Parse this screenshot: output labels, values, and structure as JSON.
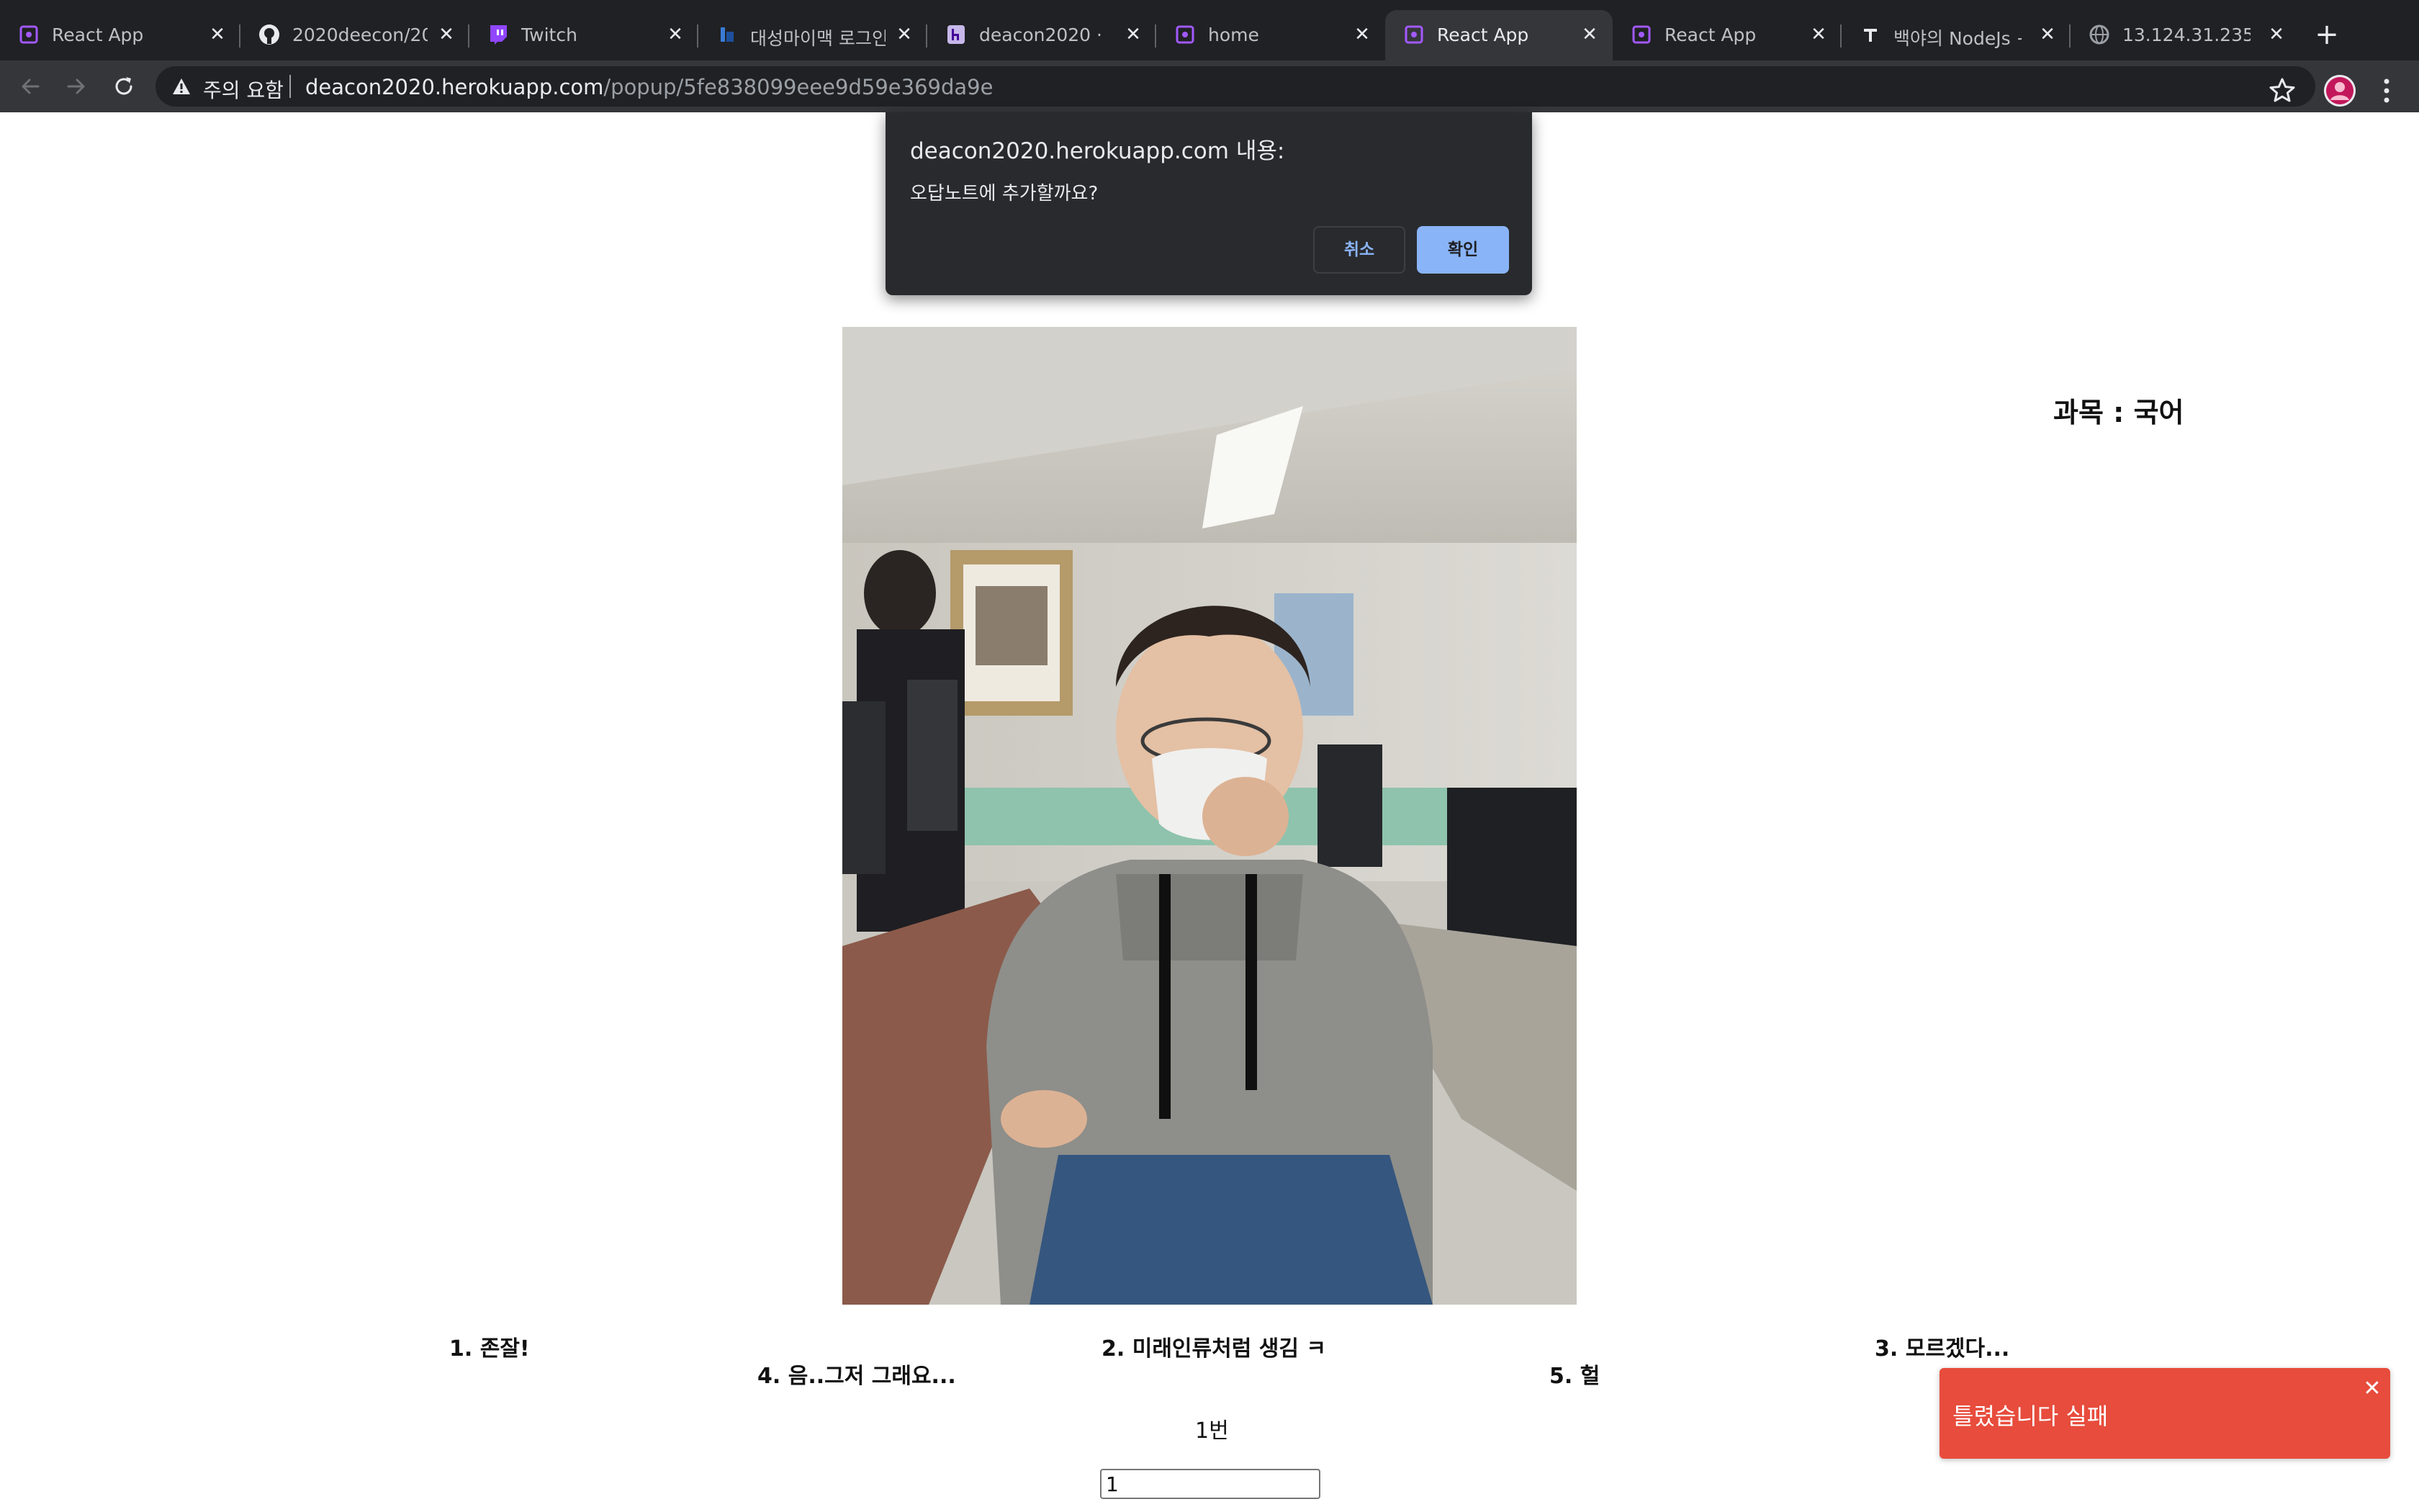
{
  "browser": {
    "tabs": [
      {
        "title": "React App",
        "icon": "react-app-icon"
      },
      {
        "title": "2020deecon/2020",
        "icon": "github-icon"
      },
      {
        "title": "Twitch",
        "icon": "twitch-icon"
      },
      {
        "title": "대성마이맥 로그인",
        "icon": "daesung-icon"
      },
      {
        "title": "deacon2020 · G",
        "icon": "heroku-icon"
      },
      {
        "title": "home",
        "icon": "react-app-icon"
      },
      {
        "title": "React App",
        "icon": "react-app-icon",
        "active": true
      },
      {
        "title": "React App",
        "icon": "react-app-icon"
      },
      {
        "title": "백야의 NodeJs +",
        "icon": "tistory-icon"
      },
      {
        "title": "13.124.31.235:3",
        "icon": "globe-icon"
      }
    ],
    "security_label": "주의 요함",
    "url_host": "deacon2020.herokuapp.com",
    "url_path": "/popup/5fe838099eee9d59e369da9e"
  },
  "page": {
    "subject": "과목 : 국어",
    "options": [
      "1. 존잘!",
      "2. 미래인류처럼 생김 ㅋ",
      "3. 모르겠다...",
      "4. 음..그저 그래요...",
      "5. 헐"
    ],
    "question_number": "1번",
    "answer_value": "1"
  },
  "dialog": {
    "title": "deacon2020.herokuapp.com 내용:",
    "message": "오답노트에 추가할까요?",
    "cancel_label": "취소",
    "ok_label": "확인"
  },
  "toast": {
    "message": "틀렸습니다 실패",
    "color": "#e74c3c"
  },
  "colors": {
    "tabstrip": "#202124",
    "toolbar": "#35363a",
    "dialog_bg": "#292a2d",
    "dialog_accent": "#8ab4f8"
  }
}
